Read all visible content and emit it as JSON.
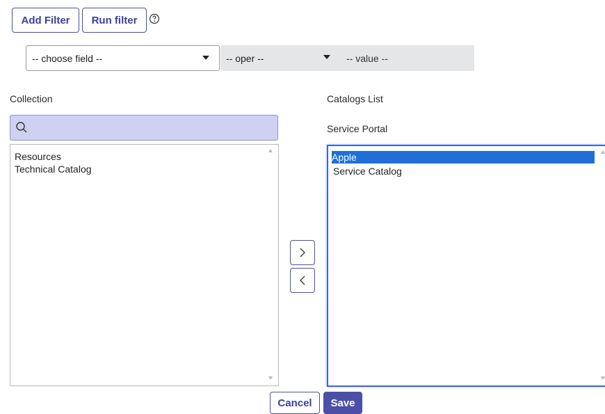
{
  "toolbar": {
    "add_filter_label": "Add Filter",
    "run_filter_label": "Run filter",
    "help_icon": "help-circle-icon"
  },
  "filter": {
    "field_value": "-- choose field --",
    "oper_value": "-- oper --",
    "value_placeholder": "-- value --"
  },
  "collection": {
    "heading": "Collection",
    "search_icon": "search-icon",
    "items": [
      "Resources",
      "Technical Catalog"
    ]
  },
  "catalogs": {
    "heading": "Catalogs List",
    "subheading": "Service Portal",
    "items": [
      "Apple",
      "Service Catalog"
    ],
    "selected_index": 0
  },
  "actions": {
    "add_icon": "chevron-right-icon",
    "remove_icon": "chevron-left-icon",
    "cancel_label": "Cancel",
    "save_label": "Save"
  },
  "colors": {
    "accent": "#4b4fa8",
    "selection": "#1f6fd6",
    "search_bg": "#cfd1f0"
  }
}
